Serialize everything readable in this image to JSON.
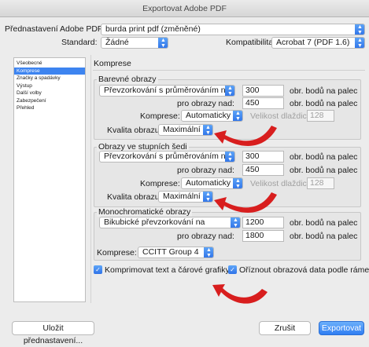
{
  "window": {
    "title": "Exportovat Adobe PDF"
  },
  "top": {
    "preset_label": "Přednastavení Adobe PDF:",
    "preset_value": "burda print pdf (změněné)",
    "standard_label": "Standard:",
    "standard_value": "Žádné",
    "compat_label": "Kompatibilita:",
    "compat_value": "Acrobat 7 (PDF 1.6)"
  },
  "sidebar": {
    "items": [
      {
        "label": "Všeobecné"
      },
      {
        "label": "Komprese"
      },
      {
        "label": "Značky a spadávky"
      },
      {
        "label": "Výstup"
      },
      {
        "label": "Další volby"
      },
      {
        "label": "Zabezpečení"
      },
      {
        "label": "Přehled"
      }
    ],
    "selected_index": 1
  },
  "panel": {
    "title": "Komprese",
    "color": {
      "title": "Barevné obrazy",
      "sampling": "Převzorkování s průměrováním na",
      "dpi": "300",
      "dpi_unit": "obr. bodů na palec",
      "above_label": "pro obrazy nad:",
      "above": "450",
      "above_unit": "obr. bodů na palec",
      "compression_label": "Komprese:",
      "compression": "Automaticky (JPEG)",
      "tile_label": "Velikost dlaždice:",
      "tile": "128",
      "quality_label": "Kvalita obrazu:",
      "quality": "Maximální"
    },
    "gray": {
      "title": "Obrazy ve stupních šedi",
      "sampling": "Převzorkování s průměrováním na",
      "dpi": "300",
      "dpi_unit": "obr. bodů na palec",
      "above_label": "pro obrazy nad:",
      "above": "450",
      "above_unit": "obr. bodů na palec",
      "compression_label": "Komprese:",
      "compression": "Automaticky (JPEG)",
      "tile_label": "Velikost dlaždice:",
      "tile": "128",
      "quality_label": "Kvalita obrazu:",
      "quality": "Maximální"
    },
    "mono": {
      "title": "Monochromatické obrazy",
      "sampling": "Bikubické převzorkování na",
      "dpi": "1200",
      "dpi_unit": "obr. bodů na palec",
      "above_label": "pro obrazy nad:",
      "above": "1800",
      "above_unit": "obr. bodů na palec",
      "compression_label": "Komprese:",
      "compression": "CCITT Group 4"
    },
    "check_text": "Komprimovat text a čárové grafiky",
    "check_crop": "Oříznout obrazová data podle rámečků"
  },
  "footer": {
    "save_preset": "Uložit přednastavení...",
    "cancel": "Zrušit",
    "export": "Exportovat"
  },
  "colors": {
    "accent": "#3d84f0",
    "arrow": "#d81e1e"
  },
  "icons": {
    "stepper": "chevron-updown-icon",
    "check": "checkmark-icon",
    "arrow": "curved-arrow-icon"
  }
}
